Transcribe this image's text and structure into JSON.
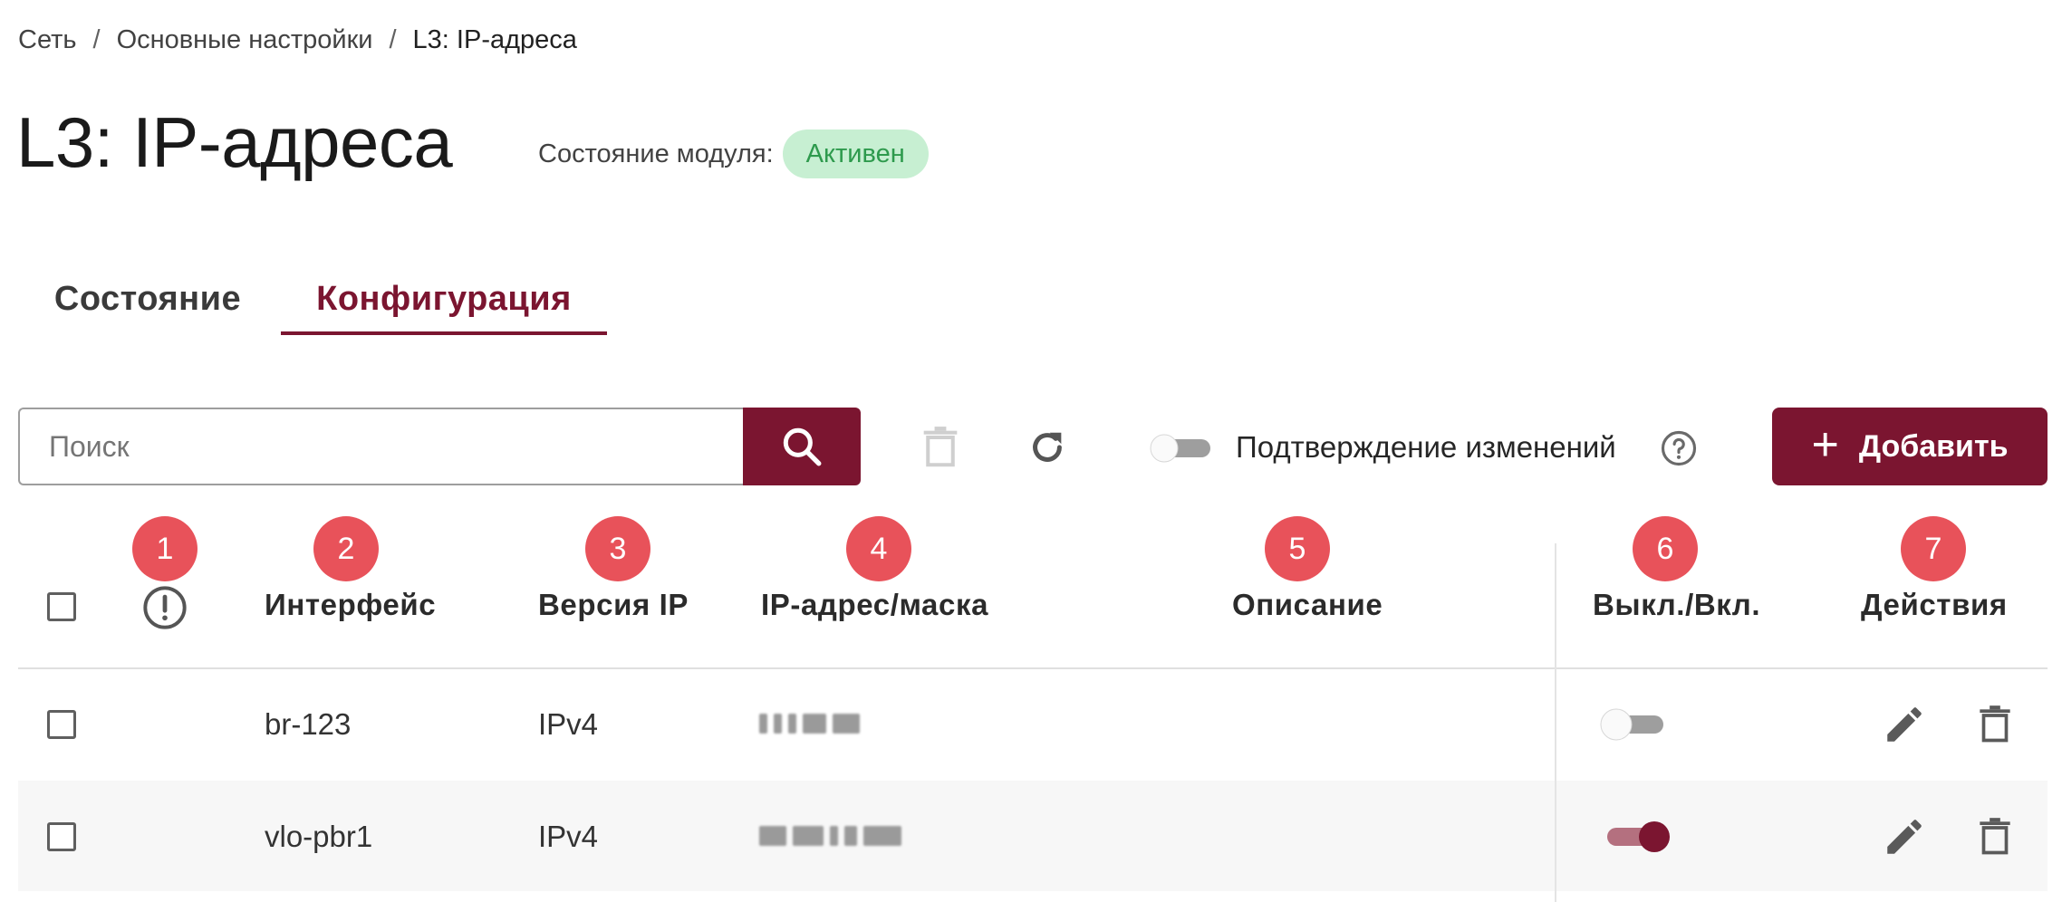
{
  "breadcrumb": {
    "items": [
      "Сеть",
      "Основные настройки",
      "L3: IP-адреса"
    ],
    "separator": "/"
  },
  "page": {
    "title": "L3: IP-адреса",
    "module_state_label": "Состояние модуля:",
    "module_state_value": "Активен"
  },
  "tabs": [
    {
      "label": "Состояние",
      "active": false
    },
    {
      "label": "Конфигурация",
      "active": true
    }
  ],
  "toolbar": {
    "search_placeholder": "Поиск",
    "search_value": "",
    "confirm_changes_label": "Подтверждение изменений",
    "confirm_changes_enabled": false,
    "add_label": "Добавить"
  },
  "markers": [
    "1",
    "2",
    "3",
    "4",
    "5",
    "6",
    "7"
  ],
  "table": {
    "columns": [
      "Интерфейс",
      "Версия IP",
      "IP-адрес/маска",
      "Описание",
      "Выкл./Вкл.",
      "Действия"
    ],
    "rows": [
      {
        "interface": "br-123",
        "ip_version": "IPv4",
        "ip_mask": "(blurred)",
        "description": "",
        "enabled": false
      },
      {
        "interface": "vlo-pbr1",
        "ip_version": "IPv4",
        "ip_mask": "(blurred)",
        "description": "",
        "enabled": true
      }
    ]
  },
  "colors": {
    "accent": "#7b1530",
    "badge_bg": "#c7efd2",
    "badge_text": "#2e9a4d",
    "marker": "#e8525a"
  },
  "icons": [
    "search-icon",
    "trash-icon",
    "refresh-icon",
    "help-icon",
    "plus-icon",
    "warning-icon",
    "edit-icon"
  ]
}
